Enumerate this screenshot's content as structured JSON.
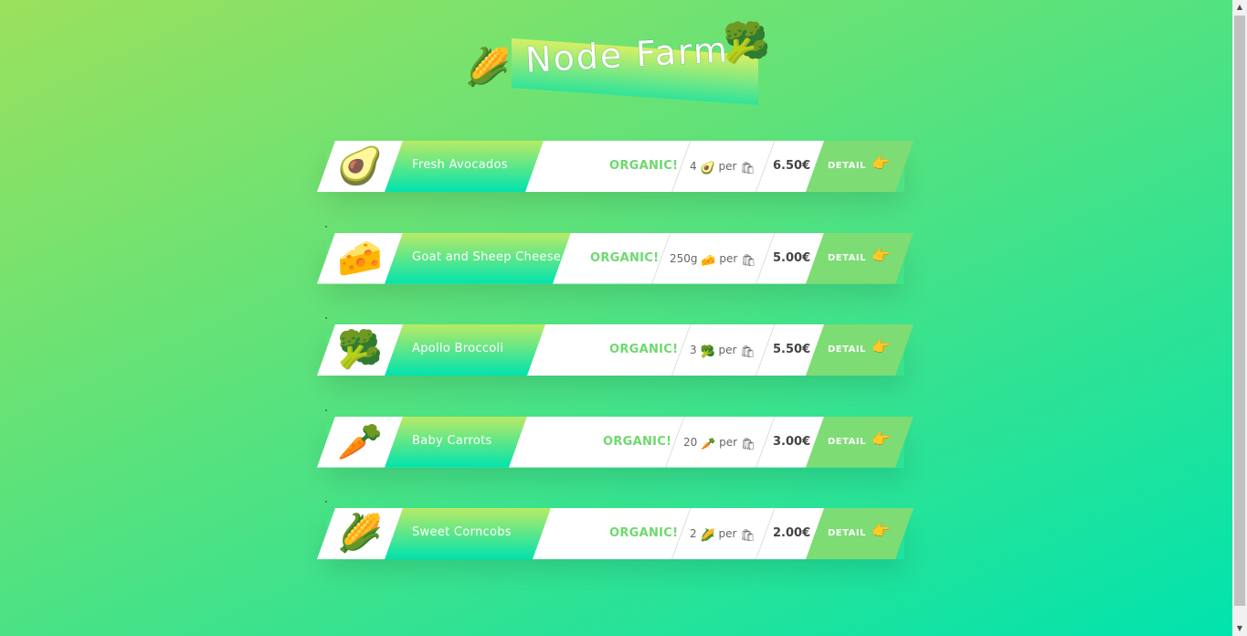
{
  "header": {
    "title": "Node Farm",
    "left_icon": "corn-icon",
    "right_icon": "broccoli-icon"
  },
  "products": [
    {
      "name": "Fresh Avocados",
      "icon": "🥑",
      "icon_name": "avocado-icon",
      "organic": "ORGANIC!",
      "quantity": "4",
      "unit_icon": "🥑",
      "per": "per",
      "price": "6.50€",
      "detail": "DETAIL"
    },
    {
      "name": "Goat and Sheep Cheese",
      "icon": "🧀",
      "icon_name": "cheese-icon",
      "organic": "ORGANIC!",
      "quantity": "250g",
      "unit_icon": "🧀",
      "per": "per",
      "price": "5.00€",
      "detail": "DETAIL"
    },
    {
      "name": "Apollo Broccoli",
      "icon": "🥦",
      "icon_name": "broccoli-icon",
      "organic": "ORGANIC!",
      "quantity": "3",
      "unit_icon": "🥦",
      "per": "per",
      "price": "5.50€",
      "detail": "DETAIL"
    },
    {
      "name": "Baby Carrots",
      "icon": "🥕",
      "icon_name": "carrot-icon",
      "organic": "ORGANIC!",
      "quantity": "20",
      "unit_icon": "🥕",
      "per": "per",
      "price": "3.00€",
      "detail": "DETAIL"
    },
    {
      "name": "Sweet Corncobs",
      "icon": "🌽",
      "icon_name": "corn-icon",
      "organic": "ORGANIC!",
      "quantity": "2",
      "unit_icon": "🌽",
      "per": "per",
      "price": "2.00€",
      "detail": "DETAIL"
    }
  ],
  "icons": {
    "corn": "🌽",
    "broccoli": "🥦",
    "bag": "🛍",
    "hand": "👉"
  },
  "colors": {
    "accent_green": "#7ddc74",
    "organic_text": "#6ed96e",
    "gradient_top": "#b8ea66",
    "gradient_bottom": "#00e3ae"
  }
}
